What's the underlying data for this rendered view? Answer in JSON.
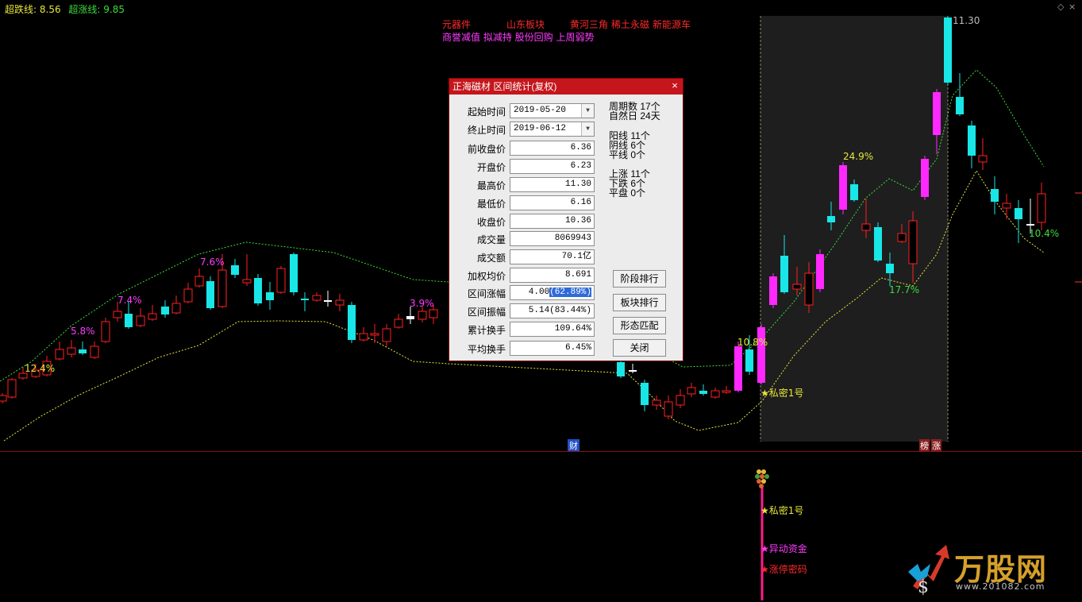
{
  "header": {
    "down_line_label": "超跌线:",
    "down_line_value": "8.56",
    "up_line_label": "超涨线:",
    "up_line_value": "9.85"
  },
  "concept_tags": {
    "row1": [
      "元器件",
      "山东板块",
      "黄河三角",
      "稀土永磁",
      "新能源车"
    ],
    "row2": "商誉减值 拟减持 股份回购 上周弱势"
  },
  "chart_labels": {
    "peak_price": "11.30",
    "pct_labels": [
      "12.4%",
      "5.8%",
      "7.4%",
      "7.6%",
      "3.9%",
      "10.8%",
      "24.9%",
      "17.7%",
      "10.4%"
    ],
    "signal_main": "★私密1号",
    "marker_cai": "财",
    "marker_bang": "榜",
    "marker_zhang": "涨"
  },
  "lower_panel": {
    "signal_1": "★私密1号",
    "signal_2": "★异动资金",
    "signal_3": "★涨停密码"
  },
  "dialog": {
    "title": "正海磁材 区间统计(复权)",
    "close_icon": "close-icon",
    "fields": {
      "start_label": "起始时间",
      "start_value": "2019-05-20",
      "end_label": "终止时间",
      "end_value": "2019-06-12",
      "prev_close_label": "前收盘价",
      "prev_close_value": "6.36",
      "open_label": "开盘价",
      "open_value": "6.23",
      "high_label": "最高价",
      "high_value": "11.30",
      "low_label": "最低价",
      "low_value": "6.16",
      "close_label": "收盘价",
      "close_value": "10.36",
      "volume_label": "成交量",
      "volume_value": "8069943",
      "amount_label": "成交额",
      "amount_value": "70.1亿",
      "vwap_label": "加权均价",
      "vwap_value": "8.691",
      "range_change_label": "区间涨幅",
      "range_change_value": "4.00",
      "range_change_pct": "(62.89%)",
      "amplitude_label": "区间振幅",
      "amplitude_value": "5.14(83.44%)",
      "cum_turnover_label": "累计换手",
      "cum_turnover_value": "109.64%",
      "avg_turnover_label": "平均换手",
      "avg_turnover_value": "6.45%"
    },
    "stats": {
      "periods_label": "周期数",
      "periods_value": "17个",
      "natural_days_label": "自然日",
      "natural_days_value": "24天",
      "yang_label": "阳线",
      "yang_value": "11个",
      "yin_label": "阴线",
      "yin_value": "6个",
      "ping_label": "平线",
      "ping_value": "0个",
      "up_label": "上涨",
      "up_value": "11个",
      "down_label": "下跌",
      "down_value": "6个",
      "flat_label": "平盘",
      "flat_value": "0个"
    },
    "buttons": {
      "stage_rank": "阶段排行",
      "sector_rank": "板块排行",
      "pattern_match": "形态匹配",
      "close": "关闭"
    }
  },
  "watermark": {
    "brand": "万股网",
    "url": "www.201082.com"
  },
  "colors": {
    "up_candle": "#ff2020",
    "down_candle": "#19e6e6",
    "limit_up": "#ff28ff",
    "band_green": "#3cdc3c",
    "band_yellow": "#e6e63c",
    "highlight_box": "#1e1e1e"
  }
}
